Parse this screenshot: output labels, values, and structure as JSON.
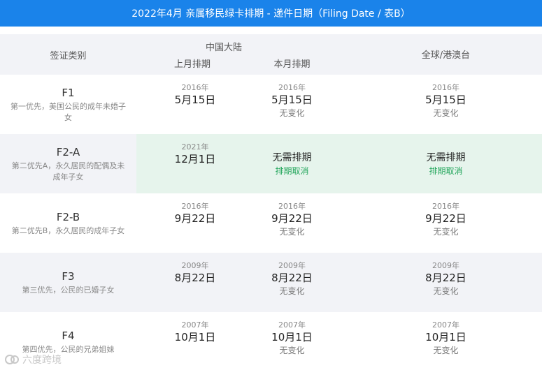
{
  "title": "2022年4月 亲属移民绿卡排期 - 递件日期（Filing Date / 表B）",
  "header": {
    "category_label": "签证类别",
    "mainland_label": "中国大陆",
    "last_month_label": "上月排期",
    "this_month_label": "本月排期",
    "global_label": "全球/港澳台"
  },
  "rows": [
    {
      "name": "F1",
      "desc": "第一优先，美国公民的成年未婚子女",
      "last": {
        "year": "2016年",
        "md": "5月15日"
      },
      "this": {
        "year": "2016年",
        "md": "5月15日",
        "note": "无变化"
      },
      "global": {
        "year": "2016年",
        "md": "5月15日",
        "note": "无变化"
      }
    },
    {
      "name": "F2-A",
      "desc": "第二优先A，永久居民的配偶及未成年子女",
      "last": {
        "year": "2021年",
        "md": "12月1日"
      },
      "this": {
        "main": "无需排期",
        "sub": "排期取消"
      },
      "global": {
        "main": "无需排期",
        "sub": "排期取消"
      }
    },
    {
      "name": "F2-B",
      "desc": "第二优先B，永久居民的成年子女",
      "last": {
        "year": "2016年",
        "md": "9月22日"
      },
      "this": {
        "year": "2016年",
        "md": "9月22日",
        "note": "无变化"
      },
      "global": {
        "year": "2016年",
        "md": "9月22日",
        "note": "无变化"
      }
    },
    {
      "name": "F3",
      "desc": "第三优先，公民的已婚子女",
      "last": {
        "year": "2009年",
        "md": "8月22日"
      },
      "this": {
        "year": "2009年",
        "md": "8月22日",
        "note": "无变化"
      },
      "global": {
        "year": "2009年",
        "md": "8月22日",
        "note": "无变化"
      }
    },
    {
      "name": "F4",
      "desc": "第四优先，公民的兄弟姐妹",
      "last": {
        "year": "2007年",
        "md": "10月1日"
      },
      "this": {
        "year": "2007年",
        "md": "10月1日",
        "note": "无变化"
      },
      "global": {
        "year": "2007年",
        "md": "10月1日",
        "note": "无变化"
      }
    }
  ],
  "watermark": "六度跨境",
  "colors": {
    "title_bg": "#1a83ea",
    "header_bg": "#f2f3f7",
    "highlight_bg": "#e6f4ec",
    "cancel_text": "#21a55a"
  }
}
